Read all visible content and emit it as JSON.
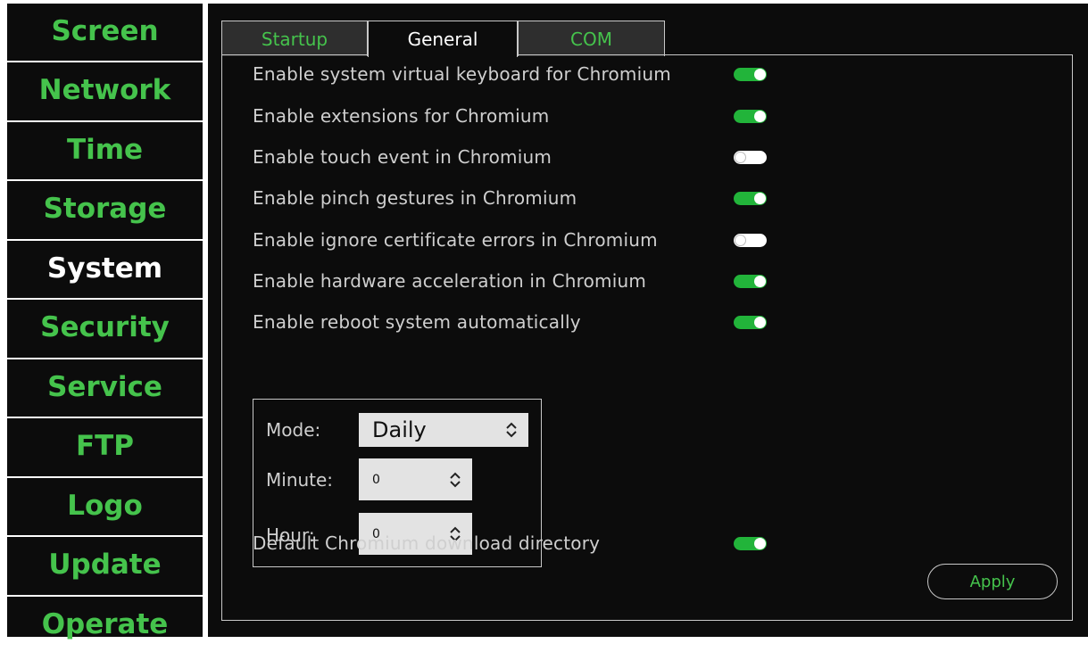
{
  "window": {
    "caption": ""
  },
  "sidebar": {
    "items": [
      {
        "label": "Screen"
      },
      {
        "label": "Network"
      },
      {
        "label": "Time"
      },
      {
        "label": "Storage"
      },
      {
        "label": "System"
      },
      {
        "label": "Security"
      },
      {
        "label": "Service"
      },
      {
        "label": "FTP"
      },
      {
        "label": "Logo"
      },
      {
        "label": "Update"
      },
      {
        "label": "Operate"
      }
    ],
    "active": "System"
  },
  "tabs": [
    {
      "label": "Startup"
    },
    {
      "label": "General"
    },
    {
      "label": "COM"
    }
  ],
  "active_tab": "General",
  "options": [
    {
      "label": "Enable system virtual keyboard for Chromium",
      "enabled": true
    },
    {
      "label": "Enable extensions for Chromium",
      "enabled": true
    },
    {
      "label": "Enable touch event in Chromium",
      "enabled": false
    },
    {
      "label": "Enable pinch gestures in Chromium",
      "enabled": true
    },
    {
      "label": "Enable ignore certificate errors in Chromium",
      "enabled": false
    },
    {
      "label": "Enable hardware acceleration in Chromium",
      "enabled": true
    },
    {
      "label": "Enable reboot system automatically",
      "enabled": true
    }
  ],
  "schedule": {
    "mode_label": "Mode:",
    "mode_value": "Daily",
    "minute_label": "Minute:",
    "minute_value": "0",
    "hour_label": "Hour:",
    "hour_value": "0"
  },
  "download_dir": {
    "label": "Default Chromium download directory",
    "enabled": true
  },
  "apply_label": "Apply",
  "colors": {
    "accent_green": "#45c34c",
    "toggle_on": "#22b43a",
    "background": "#0c0c0c",
    "text": "#cfcfcf"
  }
}
